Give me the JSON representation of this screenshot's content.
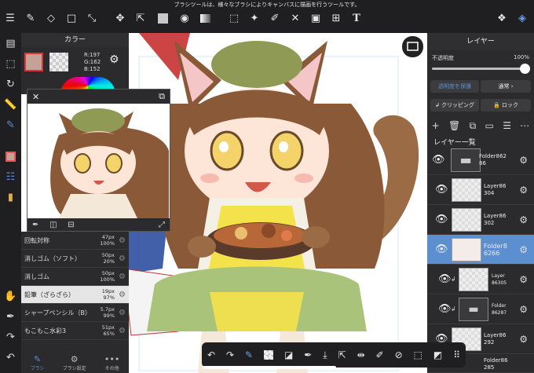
{
  "status_message": "ブラシツールは、様々なブラシによりキャンバスに描画を行うツールです。",
  "color_panel": {
    "title": "カラー",
    "rgb": [
      "R:197",
      "G:162",
      "B:152"
    ],
    "main_color": "#c5a298"
  },
  "brush_panel": {
    "rows": [
      {
        "label": "回転対称",
        "size": "47px",
        "opacity": "100%"
      },
      {
        "label": "消しゴム（ソフト）",
        "size": "50px",
        "opacity": "20%"
      },
      {
        "label": "消しゴム",
        "size": "50px",
        "opacity": "100%"
      },
      {
        "label": "鉛筆（ざらざら）",
        "size": "19px",
        "opacity": "97%"
      },
      {
        "label": "シャープペンシル（B）",
        "size": "5.7px",
        "opacity": "99%"
      },
      {
        "label": "もこもこ水彩3",
        "size": "51px",
        "opacity": "65%"
      }
    ],
    "tabs": [
      "ブラシ",
      "ブラシ設定",
      "その他"
    ]
  },
  "layer_panel": {
    "title": "レイヤー",
    "opacity_label": "不透明度",
    "opacity_value": "100%",
    "opacity_level": 1.0,
    "protect_label": "透明度を保護",
    "blend_label": "通常",
    "clipping_label": "クリッピング",
    "lock_label": "ロック",
    "list_title": "レイヤー一覧",
    "layers": [
      {
        "name": "Folder862\n86",
        "kind": "folder"
      },
      {
        "name": "Layer86\n304",
        "kind": "layer"
      },
      {
        "name": "Layer86\n302",
        "kind": "layer"
      },
      {
        "name": "Folder8\n6266",
        "kind": "folder-selected"
      },
      {
        "name": "Layer\n86305",
        "kind": "layer-clip"
      },
      {
        "name": "Folder\n86287",
        "kind": "folder-clip"
      },
      {
        "name": "Layer86\n292",
        "kind": "layer"
      },
      {
        "name": "Folder86\n285",
        "kind": "folder"
      }
    ]
  },
  "colors": {
    "accent": "#5b8fd0",
    "panel": "#2b2b2d",
    "bar": "#1f1f21"
  }
}
